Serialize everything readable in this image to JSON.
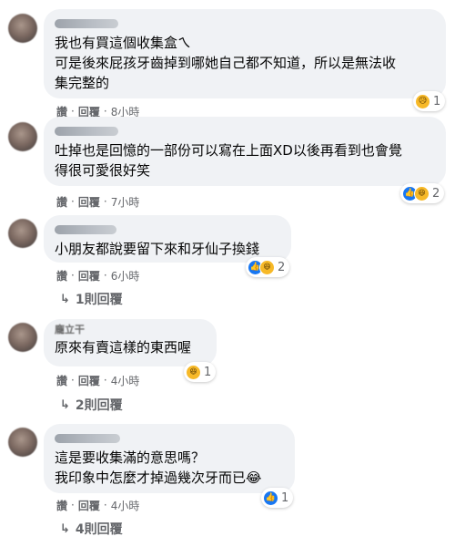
{
  "comments": [
    {
      "author": "",
      "text": "我也有買這個收集盒ㄟ\n可是後來屁孩牙齒掉到哪她自己都不知道，所以是無法收\n集完整的",
      "reaction_icons": [
        "sad-icon"
      ],
      "reaction_count": "1",
      "actions": {
        "like": "讚",
        "reply": "回覆",
        "time": "8小時"
      },
      "replies": ""
    },
    {
      "author": "",
      "text": "吐掉也是回憶的一部份可以寫在上面XD以後再看到也會覺\n得很可愛很好笑",
      "reaction_icons": [
        "like-icon",
        "haha-icon"
      ],
      "reaction_count": "2",
      "actions": {
        "like": "讚",
        "reply": "回覆",
        "time": "7小時"
      },
      "replies": ""
    },
    {
      "author": "",
      "text": "小朋友都說要留下來和牙仙子換錢",
      "reaction_icons": [
        "like-icon",
        "haha-icon"
      ],
      "reaction_count": "2",
      "actions": {
        "like": "讚",
        "reply": "回覆",
        "time": "6小時"
      },
      "replies": "1則回覆"
    },
    {
      "author": "龐立干",
      "text": "原來有賣這樣的東西喔",
      "reaction_icons": [
        "haha-icon"
      ],
      "reaction_count": "1",
      "actions": {
        "like": "讚",
        "reply": "回覆",
        "time": "4小時"
      },
      "replies": "2則回覆"
    },
    {
      "author": "",
      "text": "這是要收集滿的意思嗎？\n我印象中怎麼才掉過幾次牙而已😂",
      "reaction_icons": [
        "like-icon"
      ],
      "reaction_count": "1",
      "actions": {
        "like": "讚",
        "reply": "回覆",
        "time": "4小時"
      },
      "replies": "4則回覆"
    }
  ],
  "icons": {
    "like": "👍",
    "haha": "😆",
    "sad": "😥",
    "reply_arrow": "↳"
  },
  "colors": {
    "bubble": "#f0f2f5",
    "secondary_text": "#65676b",
    "like_blue": "#1877f2",
    "reaction_yellow": "#f7b928"
  }
}
